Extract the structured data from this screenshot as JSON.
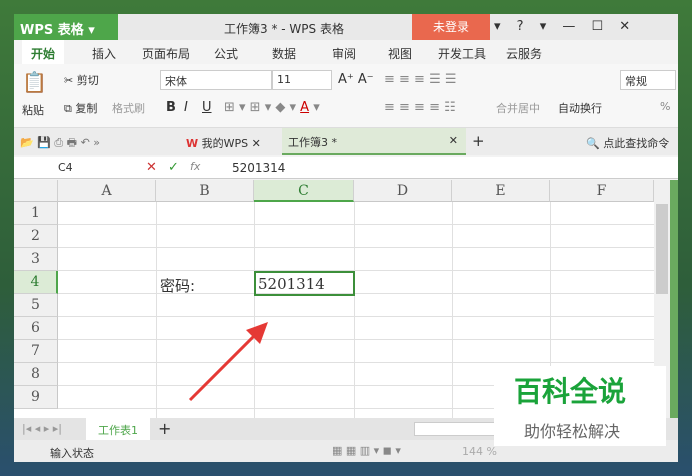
{
  "app": {
    "logo": "WPS 表格",
    "title": "工作簿3 * - WPS 表格",
    "login": "未登录",
    "controls": "▾ ? ▾ — ☐ ✕"
  },
  "menu_tabs": [
    "开始",
    "插入",
    "页面布局",
    "公式",
    "数据",
    "审阅",
    "视图",
    "开发工具",
    "云服务"
  ],
  "ribbon": {
    "paste": "粘贴",
    "cut": "剪切",
    "copy": "复制",
    "format_painter": "格式刷",
    "font": "宋体",
    "size": "11",
    "bold": "B",
    "italic": "I",
    "underline": "U",
    "merge": "合并居中",
    "wrap": "自动换行",
    "number_format": "常规",
    "percent": "%"
  },
  "doc_tabs": {
    "mywps": "我的WPS",
    "current": "工作簿3 *",
    "search": "点此查找命令"
  },
  "formula_bar": {
    "cell_ref": "C4",
    "fx": "fx",
    "value": "5201314"
  },
  "columns": [
    "A",
    "B",
    "C",
    "D",
    "E",
    "F"
  ],
  "rows": [
    "1",
    "2",
    "3",
    "4",
    "5",
    "6",
    "7",
    "8",
    "9"
  ],
  "cells": {
    "B4": "密码:",
    "C4": "5201314"
  },
  "sheet_tabs": [
    "工作表1"
  ],
  "status": {
    "mode": "输入状态",
    "zoom": "144 %"
  },
  "watermark": {
    "title": "百科全说",
    "subtitle": "助你轻松解决"
  },
  "colors": {
    "accent": "#4ea64a",
    "login": "#e9684e",
    "arrow": "#e53935"
  }
}
